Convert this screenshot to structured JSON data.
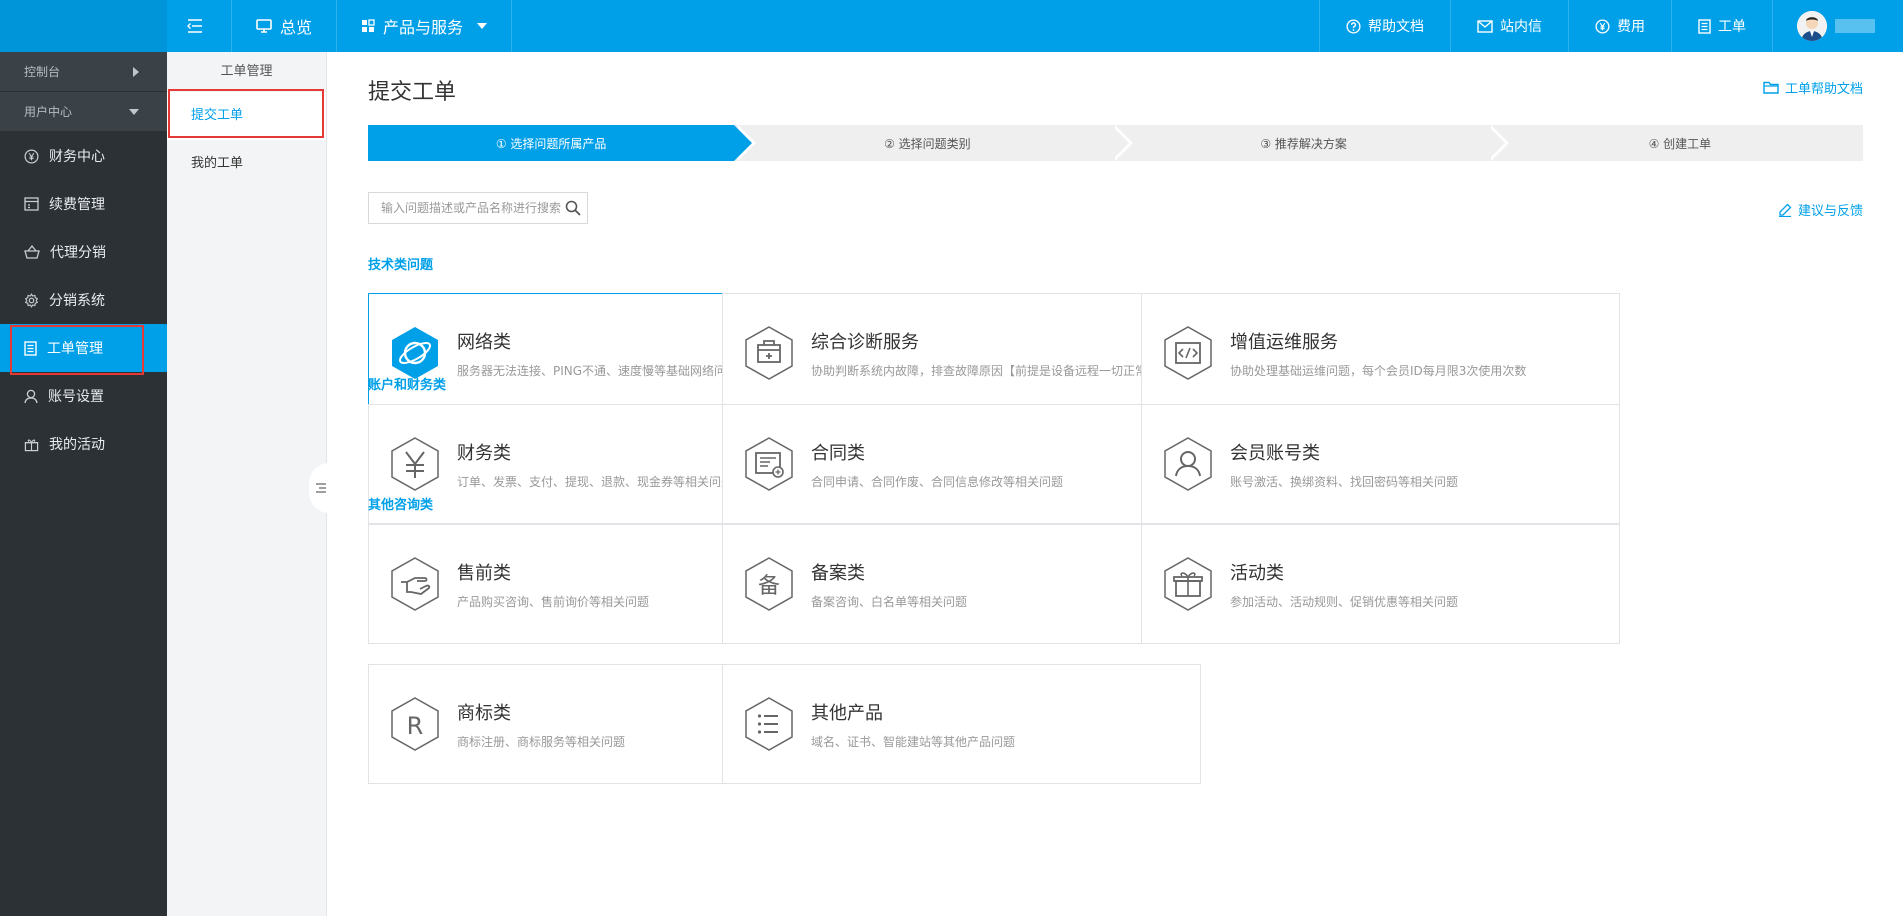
{
  "topbar": {
    "overview": "总览",
    "products": "产品与服务",
    "help_docs": "帮助文档",
    "messages": "站内信",
    "fees": "费用",
    "tickets": "工单"
  },
  "sidebar": {
    "groups": [
      "控制台",
      "用户中心"
    ],
    "items": [
      "财务中心",
      "续费管理",
      "代理分销",
      "分销系统",
      "工单管理",
      "账号设置",
      "我的活动"
    ]
  },
  "subsidebar": {
    "title": "工单管理",
    "items": [
      "提交工单",
      "我的工单"
    ]
  },
  "main": {
    "title": "提交工单",
    "help_link": "工单帮助文档",
    "steps": [
      "① 选择问题所属产品",
      "② 选择问题类别",
      "③ 推荐解决方案",
      "④ 创建工单"
    ],
    "search_placeholder": "输入问题描述或产品名称进行搜索",
    "feedback": "建议与反馈",
    "sections": [
      {
        "title": "技术类问题",
        "cards": [
          {
            "title": "网络类",
            "desc": "服务器无法连接、PING不通、速度慢等基础网络问题",
            "icon": "planet-icon"
          },
          {
            "title": "综合诊断服务",
            "desc": "协助判断系统内故障，排查故障原因【前提是设备远程一切正常】",
            "icon": "medical-kit-icon"
          },
          {
            "title": "增值运维服务",
            "desc": "协助处理基础运维问题，每个会员ID每月限3次使用次数",
            "icon": "code-icon"
          }
        ]
      },
      {
        "title": "账户和财务类",
        "cards": [
          {
            "title": "财务类",
            "desc": "订单、发票、支付、提现、退款、现金券等相关问题",
            "icon": "yen-icon"
          },
          {
            "title": "合同类",
            "desc": "合同申请、合同作废、合同信息修改等相关问题",
            "icon": "contract-icon"
          },
          {
            "title": "会员账号类",
            "desc": "账号激活、换绑资料、找回密码等相关问题",
            "icon": "user-icon"
          }
        ]
      },
      {
        "title": "其他咨询类",
        "cards": [
          {
            "title": "售前类",
            "desc": "产品购买咨询、售前询价等相关问题",
            "icon": "hand-icon"
          },
          {
            "title": "备案类",
            "desc": "备案咨询、白名单等相关问题",
            "icon": "record-icon"
          },
          {
            "title": "活动类",
            "desc": "参加活动、活动规则、促销优惠等相关问题",
            "icon": "gift-icon"
          },
          {
            "title": "商标类",
            "desc": "商标注册、商标服务等相关问题",
            "icon": "trademark-icon"
          },
          {
            "title": "其他产品",
            "desc": "域名、证书、智能建站等其他产品问题",
            "icon": "list-icon"
          }
        ]
      }
    ]
  }
}
